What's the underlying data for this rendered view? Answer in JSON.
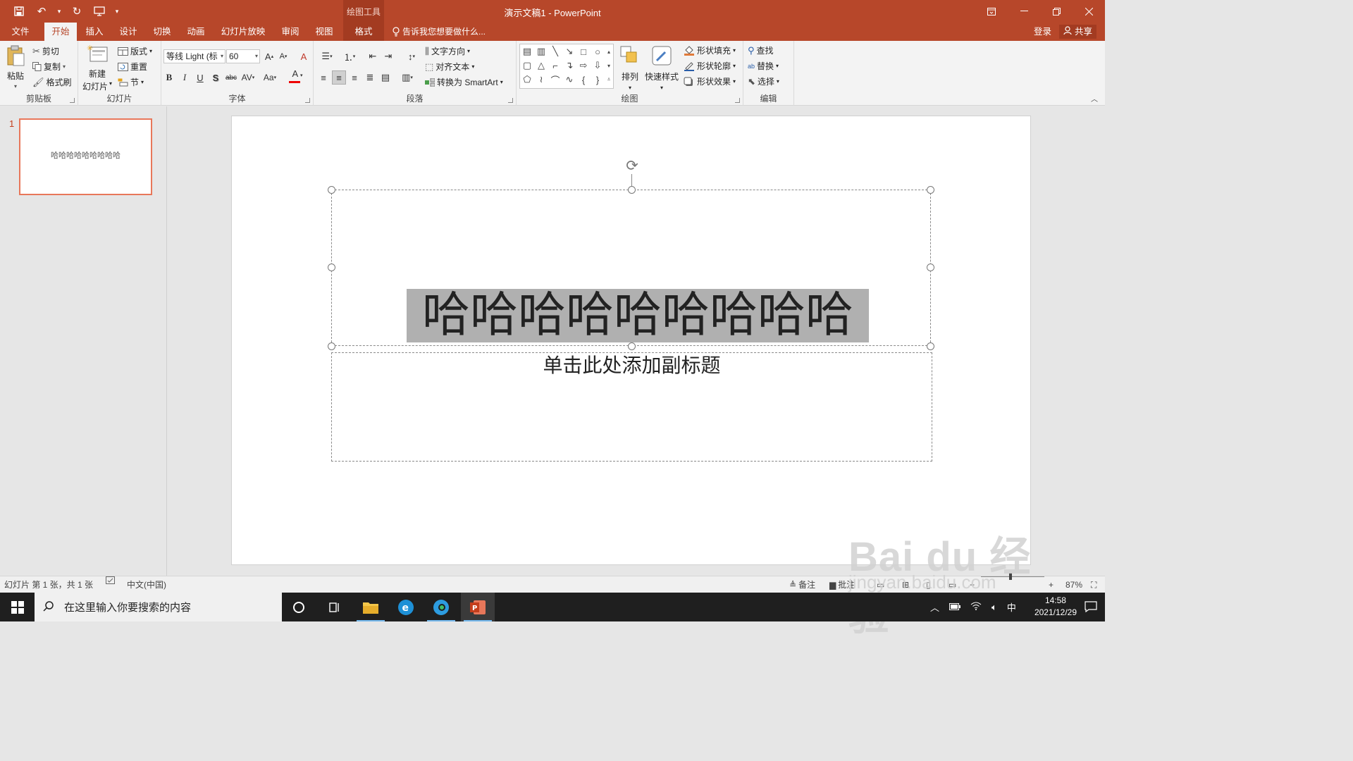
{
  "app": {
    "window_title": "演示文稿1 - PowerPoint",
    "context_group": "绘图工具"
  },
  "quick_access": {
    "save": "save-icon",
    "undo": "undo-icon",
    "redo": "redo-icon",
    "present": "start-from-beginning-icon"
  },
  "tabs": [
    {
      "label": "文件"
    },
    {
      "label": "开始"
    },
    {
      "label": "插入"
    },
    {
      "label": "设计"
    },
    {
      "label": "切换"
    },
    {
      "label": "动画"
    },
    {
      "label": "幻灯片放映"
    },
    {
      "label": "审阅"
    },
    {
      "label": "视图"
    },
    {
      "label": "格式"
    }
  ],
  "tell_me": "告诉我您想要做什么...",
  "account": {
    "login": "登录",
    "share": "共享"
  },
  "ribbon": {
    "clipboard": {
      "label": "剪贴板",
      "paste": "粘贴",
      "cut": "剪切",
      "copy": "复制",
      "format_painter": "格式刷"
    },
    "slides": {
      "label": "幻灯片",
      "new_slide_1": "新建",
      "new_slide_2": "幻灯片",
      "layout": "版式",
      "reset": "重置",
      "section": "节"
    },
    "font": {
      "label": "字体",
      "font_name": "等线 Light (标",
      "font_size": "60"
    },
    "paragraph": {
      "label": "段落",
      "text_direction": "文字方向",
      "align_text": "对齐文本",
      "convert_smartart": "转换为 SmartArt"
    },
    "drawing": {
      "label": "绘图",
      "arrange": "排列",
      "quick_styles": "快速样式",
      "shape_fill": "形状填充",
      "shape_outline": "形状轮廓",
      "shape_effects": "形状效果"
    },
    "editing": {
      "label": "编辑",
      "find": "查找",
      "replace": "替换",
      "select": "选择"
    }
  },
  "thumbnails": [
    {
      "number": "1",
      "text": "哈哈哈哈哈哈哈哈哈"
    }
  ],
  "slide": {
    "title": "哈哈哈哈哈哈哈哈哈",
    "subtitle_placeholder": "单击此处添加副标题"
  },
  "status": {
    "slide_info": "幻灯片 第 1 张，共 1 张",
    "language": "中文(中国)",
    "notes": "备注",
    "comments": "批注",
    "zoom": "87%"
  },
  "taskbar": {
    "search_placeholder": "在这里输入你要搜索的内容",
    "ime": "中",
    "time": "14:58",
    "date": "2021/12/29"
  },
  "watermark": {
    "logo": "Bai du 经验",
    "url": "jingyan.baidu.com"
  },
  "colors": {
    "accent": "#b7472a",
    "title_highlight": "#b0b0b0",
    "selection_border": "#e8775a"
  }
}
